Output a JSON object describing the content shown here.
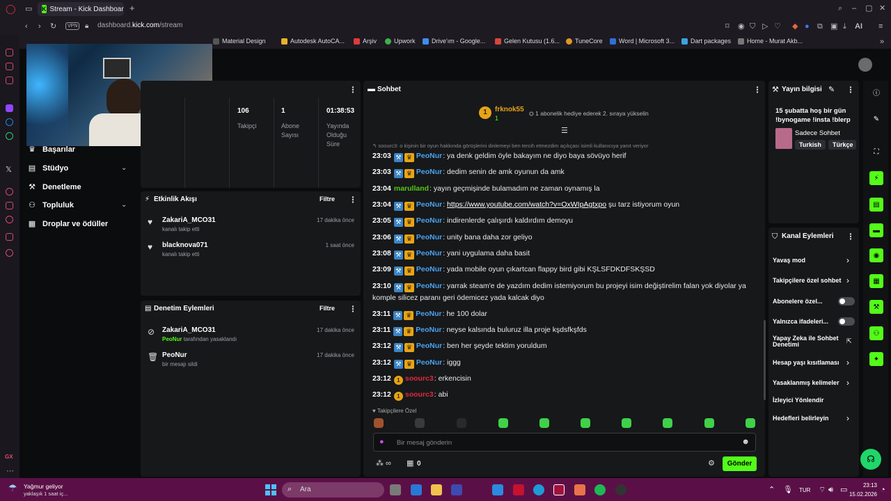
{
  "browser": {
    "tab_title": "Stream - Kick Dashboard",
    "url_prefix": "dashboard.",
    "url_domain": "kick.com",
    "url_path": "/stream",
    "vpn_label": "VPN",
    "ai_label": "AI",
    "bookmarks": [
      "Material Design",
      "Autodesk AutoCA...",
      "Arşiv",
      "Upwork",
      "Drive'ım - Google...",
      "Gelen Kutusu (1.6...",
      "TuneCore",
      "Word | Microsoft 3...",
      "Dart packages",
      "Home - Murat Akb..."
    ],
    "gx_label": "GX"
  },
  "sidebar": {
    "items": [
      {
        "label": "Başarılar",
        "icon": "trophy-icon"
      },
      {
        "label": "Stüdyo",
        "icon": "studio-icon"
      },
      {
        "label": "Denetleme",
        "icon": "wrench-icon"
      },
      {
        "label": "Topluluk",
        "icon": "community-icon"
      },
      {
        "label": "Droplar ve ödüller",
        "icon": "gift-icon"
      }
    ]
  },
  "stats": [
    {
      "value": "106",
      "label": "Takipçi"
    },
    {
      "value": "1",
      "label": "Abone Sayısı"
    },
    {
      "value": "01:38:53",
      "label": "Yayında Olduğu Süre"
    }
  ],
  "activity": {
    "title": "Etkinlik Akışı",
    "filter": "Filtre",
    "items": [
      {
        "name": "ZakariA_MCO31",
        "sub": "kanalı takip etti",
        "time": "17 dakika önce"
      },
      {
        "name": "blacknova071",
        "sub": "kanalı takip etti",
        "time": "1 saat önce"
      }
    ]
  },
  "moderation": {
    "title": "Denetim Eylemleri",
    "filter": "Filtre",
    "items": [
      {
        "name": "ZakariA_MCO31",
        "by": "PeoNur",
        "sub": "tarafından yasaklandı",
        "time": "17 dakika önce"
      },
      {
        "name": "PeoNur",
        "sub": "bir mesajı sildi",
        "time": "17 dakika önce"
      }
    ]
  },
  "chat": {
    "title": "Sohbet",
    "top_gifter": {
      "name": "frknok55",
      "rank": "1",
      "count": "1"
    },
    "gift_promo": "1 abonelik hediye ederek 2. sıraya yükselin",
    "reply_preview": "soourc3: o kişinin bir oyun hakkında görüşlerini dinlemeyi ben tercih etmezdim açıkçası isimli kullanıcıya yanıt veriyor",
    "messages": [
      {
        "time": "23:03",
        "user": "PeoNur",
        "color": "#4aa3f0",
        "text": "ya denk geldim öyle bakayım ne diyo baya sövüyo herif"
      },
      {
        "time": "23:03",
        "user": "PeoNur",
        "color": "#4aa3f0",
        "text": "dedim senin de amk oyunun da amk"
      },
      {
        "time": "23:04",
        "user": "marulland",
        "color": "#53c818",
        "text": "yayın geçmişinde bulamadım ne zaman oynamış la"
      },
      {
        "time": "23:04",
        "user": "PeoNur",
        "color": "#4aa3f0",
        "link": "https://www.youtube.com/watch?v=OxWIpAgtxpo",
        "text": "şu tarz istiyorum oyun"
      },
      {
        "time": "23:05",
        "user": "PeoNur",
        "color": "#4aa3f0",
        "text": "indirenlerde çalışırdı kaldırdım demoyu"
      },
      {
        "time": "23:06",
        "user": "PeoNur",
        "color": "#4aa3f0",
        "text": "unity bana daha zor geliyo"
      },
      {
        "time": "23:08",
        "user": "PeoNur",
        "color": "#4aa3f0",
        "text": "yani uygulama daha basit"
      },
      {
        "time": "23:09",
        "user": "PeoNur",
        "color": "#4aa3f0",
        "text": "yada mobile oyun çıkartcan flappy bird gibi KŞLSFDKDFSKŞSD"
      },
      {
        "time": "23:10",
        "user": "PeoNur",
        "color": "#4aa3f0",
        "text": "yarrak steam'e de yazdım dedim istemiyorum bu projeyi isim değiştirelim falan yok diyolar ya komple silicez paranı geri ödemicez yada kalcak diyo"
      },
      {
        "time": "23:11",
        "user": "PeoNur",
        "color": "#4aa3f0",
        "text": "he 100 dolar"
      },
      {
        "time": "23:11",
        "user": "PeoNur",
        "color": "#4aa3f0",
        "text": "neyse kalsında buluruz illa proje kşdsfkşfds"
      },
      {
        "time": "23:12",
        "user": "PeoNur",
        "color": "#4aa3f0",
        "text": "ben her şeyde tektim yoruldum"
      },
      {
        "time": "23:12",
        "user": "PeoNur",
        "color": "#4aa3f0",
        "text": "iggg"
      },
      {
        "time": "23:12",
        "user": "soourc3",
        "color": "#e0283c",
        "text": "erkencisin"
      },
      {
        "time": "23:12",
        "user": "soourc3",
        "color": "#e0283c",
        "text": "abi"
      }
    ],
    "emote_label": "Takipçilere Özel",
    "input_placeholder": "Bir mesaj gönderin",
    "points": "0",
    "send": "Gönder"
  },
  "stream_info": {
    "title": "Yayın bilgisi",
    "stream_title": "15 şubatta hoş bir gün !bynogame !insta !blerp",
    "category": "Sadece Sohbet",
    "tags": [
      "Turkish",
      "Türkçe"
    ]
  },
  "channel_actions": {
    "title": "Kanal Eylemleri",
    "items": [
      {
        "label": "Yavaş mod",
        "kind": "arrow"
      },
      {
        "label": "Takipçilere özel sohbet",
        "kind": "arrow"
      },
      {
        "label": "Abonelere özel...",
        "kind": "toggle"
      },
      {
        "label": "Yalnızca ifadeleri...",
        "kind": "toggle"
      },
      {
        "label": "Yapay Zeka ile Sohbet Denetimi",
        "kind": "external"
      },
      {
        "label": "Hesap yaşı kısıtlaması",
        "kind": "arrow"
      },
      {
        "label": "Yasaklanmış kelimeler",
        "kind": "arrow"
      },
      {
        "label": "İzleyici Yönlendir",
        "kind": "none"
      },
      {
        "label": "Hedefleri belirleyin",
        "kind": "arrow"
      }
    ]
  },
  "taskbar": {
    "weather_title": "Yağmur geliyor",
    "weather_sub": "yaklaşık 1 saat iç...",
    "search": "Ara",
    "lang": "TUR",
    "time": "23:13",
    "date": "15.02.2026"
  }
}
